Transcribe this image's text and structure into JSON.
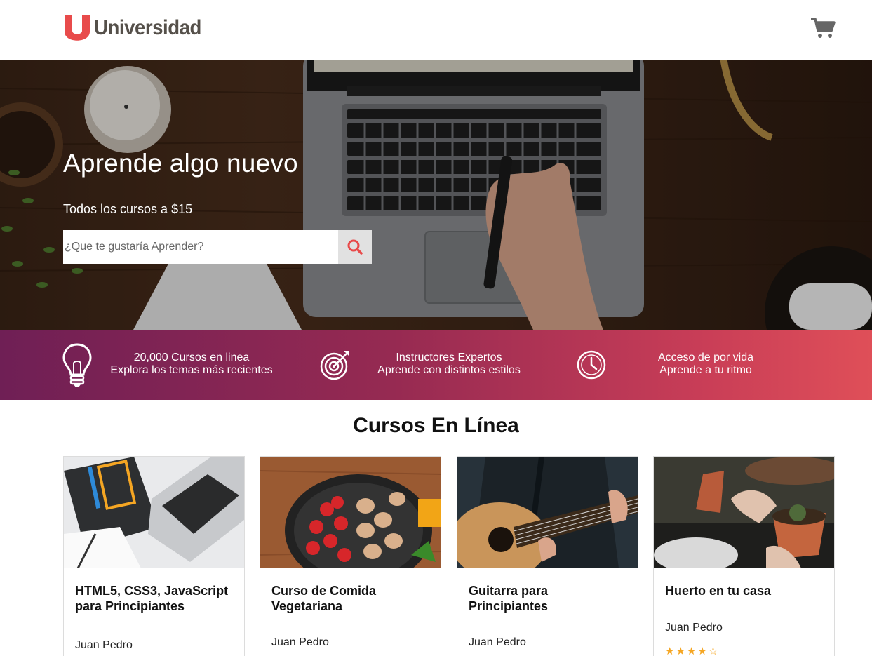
{
  "header": {
    "logo_text": "Universidad",
    "logo_letter": "U",
    "cart_icon": "shopping-cart-icon"
  },
  "hero": {
    "title": "Aprende algo nuevo",
    "subtitle": "Todos los cursos a $15",
    "search_placeholder": "¿Que te gustaría Aprender?",
    "search_icon": "search-icon"
  },
  "features": [
    {
      "icon": "lightbulb-icon",
      "line1": "20,000 Cursos en linea",
      "line2": "Explora los temas más recientes"
    },
    {
      "icon": "target-icon",
      "line1": "Instructores Expertos",
      "line2": "Aprende con distintos estilos"
    },
    {
      "icon": "clock-icon",
      "line1": "Acceso de por vida",
      "line2": "Aprende a tu ritmo"
    }
  ],
  "courses": {
    "title": "Cursos En Línea",
    "items": [
      {
        "title": "HTML5, CSS3, JavaScript para Principiantes",
        "author": "Juan Pedro"
      },
      {
        "title": "Curso de Comida Vegetariana",
        "author": "Juan Pedro"
      },
      {
        "title": "Guitarra para Principiantes",
        "author": "Juan Pedro"
      },
      {
        "title": "Huerto en tu casa",
        "author": "Juan Pedro",
        "rating": 4.5,
        "stars": "★★★★☆"
      }
    ]
  },
  "colors": {
    "brand_red": "#e84b4b",
    "logo_gray": "#55504a",
    "band_start": "#6f1f55",
    "band_end": "#df4f58",
    "star": "#f5a623"
  }
}
